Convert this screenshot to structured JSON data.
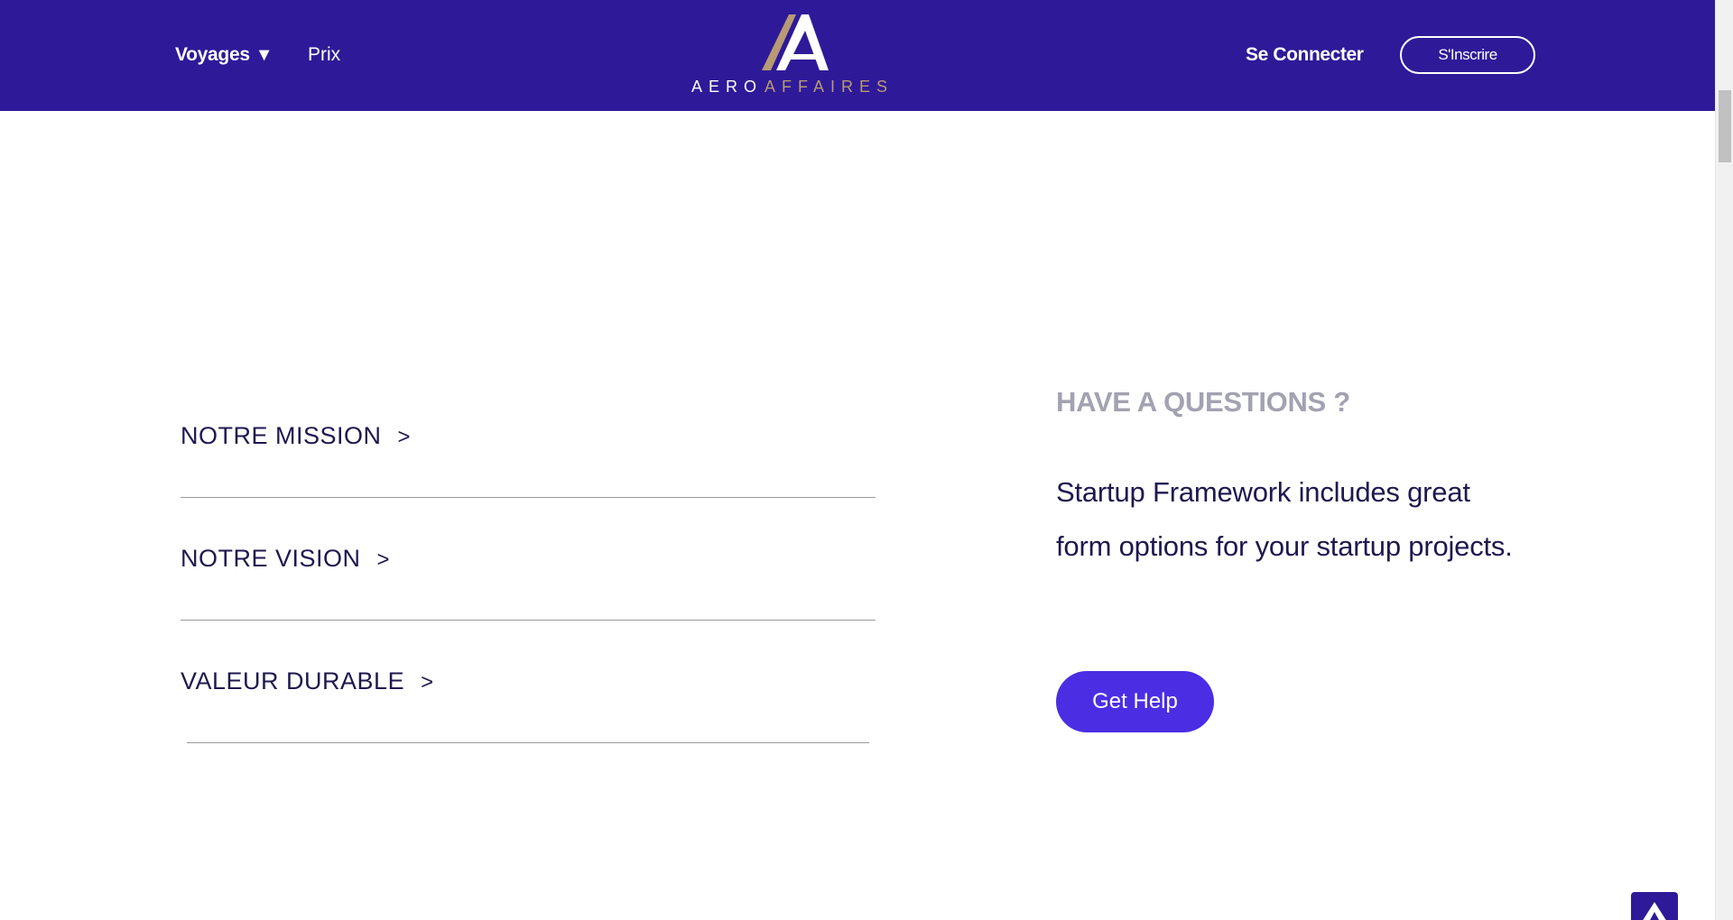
{
  "header": {
    "nav": {
      "voyages_label": "Voyages",
      "voyages_caret": "▼",
      "prix_label": "Prix"
    },
    "logo": {
      "word1": "AERO",
      "word2": "AFFAIRES",
      "icon": "aero-affaires-logo-icon"
    },
    "login_label": "Se Connecter",
    "signup_label": "S'Inscrire"
  },
  "accordion": {
    "items": [
      {
        "label": "NOTRE MISSION",
        "chevron": ">"
      },
      {
        "label": "NOTRE VISION",
        "chevron": ">"
      },
      {
        "label": "VALEUR DURABLE",
        "chevron": ">"
      }
    ]
  },
  "help": {
    "heading": "HAVE A QUESTIONS ?",
    "text": "Startup Framework includes great form options for your startup projects.",
    "button_label": "Get Help"
  },
  "back_to_top": {
    "icon": "arrow-up-icon"
  },
  "colors": {
    "header_bg": "#2e1a98",
    "logo_gold": "#b89a74",
    "text_dark": "#1f1850",
    "heading_grey": "#a2a2b2",
    "button_bg": "#4b2de4"
  }
}
